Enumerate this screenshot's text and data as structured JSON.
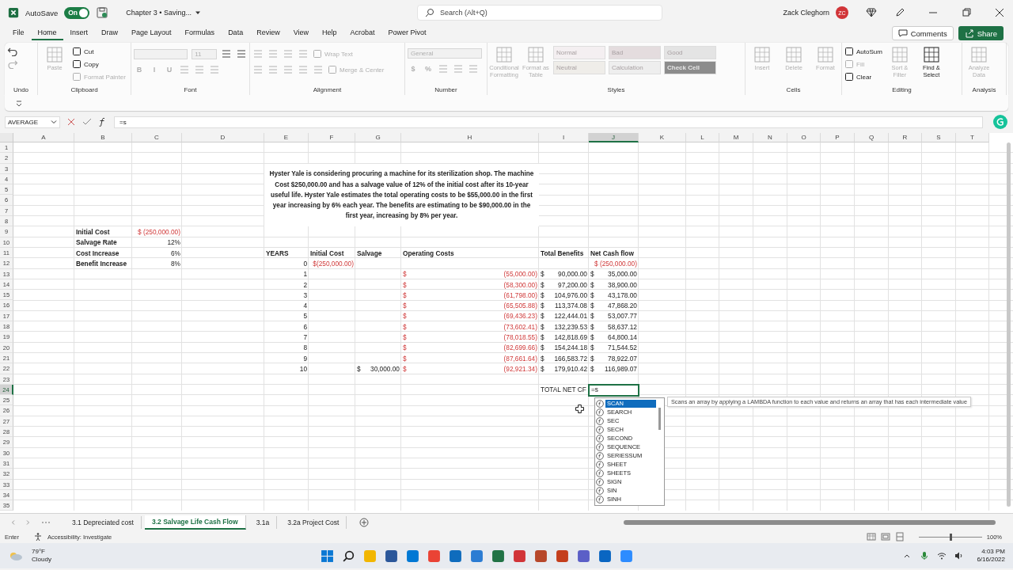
{
  "title_bar": {
    "autosave_label": "AutoSave",
    "autosave_toggle": {
      "text": "On",
      "on": true
    },
    "document": "Chapter 3 • Saving...",
    "search": {
      "placeholder": "Search (Alt+Q)"
    },
    "user": "Zack Cleghorn",
    "avatar": "ZC"
  },
  "menu": {
    "tabs": [
      {
        "label": "File",
        "selected": false
      },
      {
        "label": "Home",
        "selected": true
      },
      {
        "label": "Insert",
        "selected": false
      },
      {
        "label": "Draw",
        "selected": false
      },
      {
        "label": "Page Layout",
        "selected": false
      },
      {
        "label": "Formulas",
        "selected": false
      },
      {
        "label": "Data",
        "selected": false
      },
      {
        "label": "Review",
        "selected": false
      },
      {
        "label": "View",
        "selected": false
      },
      {
        "label": "Help",
        "selected": false
      },
      {
        "label": "Acrobat",
        "selected": false
      },
      {
        "label": "Power Pivot",
        "selected": false
      }
    ],
    "comments": "Comments",
    "share": "Share"
  },
  "ribbon": {
    "groups": [
      {
        "label": "Undo",
        "columns": [
          [
            {
              "kind": "undo",
              "disabled": false
            },
            {
              "kind": "redo",
              "disabled": true
            }
          ]
        ]
      },
      {
        "label": "Clipboard",
        "columns": [
          [
            {
              "kind": "large",
              "label": "Paste",
              "disabled": true
            }
          ],
          [
            {
              "kind": "small",
              "label": "Cut",
              "disabled": false
            },
            {
              "kind": "small",
              "label": "Copy",
              "disabled": false
            },
            {
              "kind": "small",
              "label": "Format Painter",
              "disabled": true
            }
          ]
        ]
      },
      {
        "label": "Font",
        "rows": [
          [
            {
              "kind": "font-field",
              "disabled": true
            },
            {
              "kind": "size-field",
              "value": "11",
              "disabled": true
            },
            {
              "kind": "icon",
              "disabled": false
            },
            {
              "kind": "icon",
              "disabled": false
            }
          ],
          [
            {
              "kind": "glyph",
              "label": "B",
              "disabled": true
            },
            {
              "kind": "glyph",
              "label": "I",
              "disabled": true
            },
            {
              "kind": "glyph",
              "label": "U",
              "disabled": true
            },
            {
              "kind": "icon",
              "disabled": true
            },
            {
              "kind": "icon",
              "disabled": true
            },
            {
              "kind": "icon",
              "disabled": true
            }
          ]
        ]
      },
      {
        "label": "Alignment",
        "rows": [
          [
            {
              "kind": "icon",
              "disabled": true
            },
            {
              "kind": "icon",
              "disabled": true
            },
            {
              "kind": "icon",
              "disabled": true
            },
            {
              "kind": "icon",
              "disabled": true
            },
            {
              "kind": "small",
              "label": "Wrap Text",
              "disabled": true
            }
          ],
          [
            {
              "kind": "icon",
              "disabled": true
            },
            {
              "kind": "icon",
              "disabled": true
            },
            {
              "kind": "icon",
              "disabled": true
            },
            {
              "kind": "icon",
              "disabled": true
            },
            {
              "kind": "icon",
              "disabled": true
            },
            {
              "kind": "small",
              "label": "Merge & Center",
              "disabled": true
            }
          ]
        ]
      },
      {
        "label": "Number",
        "rows": [
          [
            {
              "kind": "format-field",
              "value": "General",
              "disabled": true
            }
          ],
          [
            {
              "kind": "glyph",
              "label": "$",
              "disabled": true
            },
            {
              "kind": "glyph",
              "label": "%",
              "disabled": true
            },
            {
              "kind": "icon",
              "disabled": true
            },
            {
              "kind": "icon",
              "disabled": true
            },
            {
              "kind": "icon",
              "disabled": true
            }
          ]
        ]
      },
      {
        "label": "Styles",
        "columns": [
          [
            {
              "kind": "large",
              "label": "Conditional Formatting",
              "disabled": true
            }
          ],
          [
            {
              "kind": "large",
              "label": "Format as Table",
              "disabled": true
            }
          ],
          [
            {
              "kind": "style",
              "label": "Normal",
              "color": "#f4eff1",
              "disabled": true
            },
            {
              "kind": "style",
              "label": "Neutral",
              "color": "#efede9",
              "disabled": true
            }
          ],
          [
            {
              "kind": "style",
              "label": "Bad",
              "color": "#e4dcde",
              "disabled": true
            },
            {
              "kind": "style",
              "label": "Calculation",
              "color": "#eeeeee",
              "disabled": true
            }
          ],
          [
            {
              "kind": "style",
              "label": "Good",
              "color": "#e4e4e4",
              "disabled": true
            },
            {
              "kind": "style",
              "label": "Check Cell",
              "color": "#8c8c8c",
              "disabled": true
            }
          ]
        ]
      },
      {
        "label": "Cells",
        "columns": [
          [
            {
              "kind": "large",
              "label": "Insert",
              "disabled": true
            }
          ],
          [
            {
              "kind": "large",
              "label": "Delete",
              "disabled": true
            }
          ],
          [
            {
              "kind": "large",
              "label": "Format",
              "disabled": true
            }
          ]
        ]
      },
      {
        "label": "Editing",
        "columns": [
          [
            {
              "kind": "small",
              "label": "AutoSum",
              "disabled": false
            },
            {
              "kind": "small",
              "label": "Fill",
              "disabled": true
            },
            {
              "kind": "small",
              "label": "Clear",
              "disabled": false
            }
          ],
          [
            {
              "kind": "large",
              "label": "Sort & Filter",
              "disabled": true
            }
          ],
          [
            {
              "kind": "large",
              "label": "Find & Select",
              "disabled": false
            }
          ]
        ]
      },
      {
        "label": "Analysis",
        "columns": [
          [
            {
              "kind": "large",
              "label": "Analyze Data",
              "disabled": true
            }
          ]
        ]
      }
    ]
  },
  "formula_bar": {
    "name_box": "AVERAGE",
    "formula": "=s"
  },
  "sheet": {
    "columns": [
      {
        "label": "A",
        "selected": false
      },
      {
        "label": "B",
        "selected": false
      },
      {
        "label": "C",
        "selected": false
      },
      {
        "label": "D",
        "selected": false
      },
      {
        "label": "E",
        "selected": false
      },
      {
        "label": "F",
        "selected": false
      },
      {
        "label": "G",
        "selected": false
      },
      {
        "label": "H",
        "selected": false
      },
      {
        "label": "I",
        "selected": false
      },
      {
        "label": "J",
        "selected": true
      },
      {
        "label": "K",
        "selected": false
      },
      {
        "label": "L",
        "selected": false
      },
      {
        "label": "M",
        "selected": false
      },
      {
        "label": "N",
        "selected": false
      },
      {
        "label": "O",
        "selected": false
      },
      {
        "label": "P",
        "selected": false
      },
      {
        "label": "Q",
        "selected": false
      },
      {
        "label": "R",
        "selected": false
      },
      {
        "label": "S",
        "selected": false
      },
      {
        "label": "T",
        "selected": false
      }
    ],
    "note": "Hyster Yale is considering procuring a machine for its sterilization shop. The machine Cost $250,000.00 and has a salvage value of 12% of the initial cost after its 10-year useful life. Hyster Yale estimates the total operating costs to be $55,000.00 in the first year increasing by 6% each year. The benefits are estimating to be $90,000.00 in the first year, increasing by 8% per year.",
    "rows": [
      {
        "number": "1",
        "selected": false
      },
      {
        "number": "2",
        "selected": false
      },
      {
        "number": "3",
        "selected": false
      },
      {
        "number": "4",
        "selected": false
      },
      {
        "number": "5",
        "selected": false
      },
      {
        "number": "6",
        "selected": false
      },
      {
        "number": "7",
        "selected": false
      },
      {
        "number": "8",
        "selected": false
      },
      {
        "number": "9",
        "selected": false,
        "B": {
          "kind": "text",
          "text": "Initial Cost",
          "bold": true,
          "negative": false
        },
        "C": {
          "kind": "number",
          "text": "$ (250,000.00)",
          "bold": false,
          "negative": true
        }
      },
      {
        "number": "10",
        "selected": false,
        "B": {
          "kind": "text",
          "text": "Salvage Rate",
          "bold": true,
          "negative": false
        },
        "C": {
          "kind": "number",
          "text": "12%",
          "bold": false,
          "negative": false
        }
      },
      {
        "number": "11",
        "selected": false,
        "B": {
          "kind": "text",
          "text": "Cost Increase",
          "bold": true,
          "negative": false
        },
        "C": {
          "kind": "number",
          "text": "6%",
          "bold": false,
          "negative": false
        },
        "E": {
          "kind": "text",
          "text": "YEARS",
          "bold": true,
          "negative": false
        },
        "F": {
          "kind": "text",
          "text": "Initial Cost",
          "bold": true,
          "negative": false
        },
        "G": {
          "kind": "text",
          "text": "Salvage",
          "bold": true,
          "negative": false
        },
        "H": {
          "kind": "text",
          "text": "Operating Costs",
          "bold": true,
          "negative": false
        },
        "I": {
          "kind": "text",
          "text": "Total Benefits",
          "bold": true,
          "negative": false
        },
        "J": {
          "kind": "text",
          "text": "Net Cash flow",
          "bold": true,
          "negative": false
        }
      },
      {
        "number": "12",
        "selected": false,
        "B": {
          "kind": "text",
          "text": "Benefit Increase",
          "bold": true,
          "negative": false
        },
        "C": {
          "kind": "number",
          "text": "8%",
          "bold": false,
          "negative": false
        },
        "E": {
          "kind": "number",
          "text": "0",
          "bold": false,
          "negative": false
        },
        "F": {
          "kind": "number",
          "text": "$(250,000.00)",
          "bold": false,
          "negative": true
        },
        "J": {
          "kind": "number",
          "text": "$ (250,000.00)",
          "bold": false,
          "negative": true
        }
      },
      {
        "number": "13",
        "selected": false,
        "E": {
          "kind": "number",
          "text": "1",
          "bold": false,
          "negative": false
        },
        "H": {
          "kind": "accounting",
          "symbol": "$",
          "text": "(55,000.00)",
          "bold": false,
          "negative": true
        },
        "I": {
          "kind": "accounting",
          "symbol": "$",
          "text": "90,000.00",
          "bold": false,
          "negative": false
        },
        "J": {
          "kind": "accounting",
          "symbol": "$",
          "text": "35,000.00",
          "bold": false,
          "negative": false
        }
      },
      {
        "number": "14",
        "selected": false,
        "E": {
          "kind": "number",
          "text": "2",
          "bold": false,
          "negative": false
        },
        "H": {
          "kind": "accounting",
          "symbol": "$",
          "text": "(58,300.00)",
          "bold": false,
          "negative": true
        },
        "I": {
          "kind": "accounting",
          "symbol": "$",
          "text": "97,200.00",
          "bold": false,
          "negative": false
        },
        "J": {
          "kind": "accounting",
          "symbol": "$",
          "text": "38,900.00",
          "bold": false,
          "negative": false
        }
      },
      {
        "number": "15",
        "selected": false,
        "E": {
          "kind": "number",
          "text": "3",
          "bold": false,
          "negative": false
        },
        "H": {
          "kind": "accounting",
          "symbol": "$",
          "text": "(61,798.00)",
          "bold": false,
          "negative": true
        },
        "I": {
          "kind": "accounting",
          "symbol": "$",
          "text": "104,976.00",
          "bold": false,
          "negative": false
        },
        "J": {
          "kind": "accounting",
          "symbol": "$",
          "text": "43,178.00",
          "bold": false,
          "negative": false
        }
      },
      {
        "number": "16",
        "selected": false,
        "E": {
          "kind": "number",
          "text": "4",
          "bold": false,
          "negative": false
        },
        "H": {
          "kind": "accounting",
          "symbol": "$",
          "text": "(65,505.88)",
          "bold": false,
          "negative": true
        },
        "I": {
          "kind": "accounting",
          "symbol": "$",
          "text": "113,374.08",
          "bold": false,
          "negative": false
        },
        "J": {
          "kind": "accounting",
          "symbol": "$",
          "text": "47,868.20",
          "bold": false,
          "negative": false
        }
      },
      {
        "number": "17",
        "selected": false,
        "E": {
          "kind": "number",
          "text": "5",
          "bold": false,
          "negative": false
        },
        "H": {
          "kind": "accounting",
          "symbol": "$",
          "text": "(69,436.23)",
          "bold": false,
          "negative": true
        },
        "I": {
          "kind": "accounting",
          "symbol": "$",
          "text": "122,444.01",
          "bold": false,
          "negative": false
        },
        "J": {
          "kind": "accounting",
          "symbol": "$",
          "text": "53,007.77",
          "bold": false,
          "negative": false
        }
      },
      {
        "number": "18",
        "selected": false,
        "E": {
          "kind": "number",
          "text": "6",
          "bold": false,
          "negative": false
        },
        "H": {
          "kind": "accounting",
          "symbol": "$",
          "text": "(73,602.41)",
          "bold": false,
          "negative": true
        },
        "I": {
          "kind": "accounting",
          "symbol": "$",
          "text": "132,239.53",
          "bold": false,
          "negative": false
        },
        "J": {
          "kind": "accounting",
          "symbol": "$",
          "text": "58,637.12",
          "bold": false,
          "negative": false
        }
      },
      {
        "number": "19",
        "selected": false,
        "E": {
          "kind": "number",
          "text": "7",
          "bold": false,
          "negative": false
        },
        "H": {
          "kind": "accounting",
          "symbol": "$",
          "text": "(78,018.55)",
          "bold": false,
          "negative": true
        },
        "I": {
          "kind": "accounting",
          "symbol": "$",
          "text": "142,818.69",
          "bold": false,
          "negative": false
        },
        "J": {
          "kind": "accounting",
          "symbol": "$",
          "text": "64,800.14",
          "bold": false,
          "negative": false
        }
      },
      {
        "number": "20",
        "selected": false,
        "E": {
          "kind": "number",
          "text": "8",
          "bold": false,
          "negative": false
        },
        "H": {
          "kind": "accounting",
          "symbol": "$",
          "text": "(82,699.66)",
          "bold": false,
          "negative": true
        },
        "I": {
          "kind": "accounting",
          "symbol": "$",
          "text": "154,244.18",
          "bold": false,
          "negative": false
        },
        "J": {
          "kind": "accounting",
          "symbol": "$",
          "text": "71,544.52",
          "bold": false,
          "negative": false
        }
      },
      {
        "number": "21",
        "selected": false,
        "E": {
          "kind": "number",
          "text": "9",
          "bold": false,
          "negative": false
        },
        "H": {
          "kind": "accounting",
          "symbol": "$",
          "text": "(87,661.64)",
          "bold": false,
          "negative": true
        },
        "I": {
          "kind": "accounting",
          "symbol": "$",
          "text": "166,583.72",
          "bold": false,
          "negative": false
        },
        "J": {
          "kind": "accounting",
          "symbol": "$",
          "text": "78,922.07",
          "bold": false,
          "negative": false
        }
      },
      {
        "number": "22",
        "selected": false,
        "E": {
          "kind": "number",
          "text": "10",
          "bold": false,
          "negative": false
        },
        "G": {
          "kind": "accounting",
          "symbol": "$",
          "text": "30,000.00",
          "bold": false,
          "negative": false
        },
        "H": {
          "kind": "accounting",
          "symbol": "$",
          "text": "(92,921.34)",
          "bold": false,
          "negative": true
        },
        "I": {
          "kind": "accounting",
          "symbol": "$",
          "text": "179,910.42",
          "bold": false,
          "negative": false
        },
        "J": {
          "kind": "accounting",
          "symbol": "$",
          "text": "116,989.07",
          "bold": false,
          "negative": false
        }
      },
      {
        "number": "23",
        "selected": false
      },
      {
        "number": "24",
        "selected": true,
        "I": {
          "kind": "text",
          "text": "TOTAL NET CF",
          "bold": false,
          "negative": false
        },
        "J": {
          "kind": "editing",
          "text": "=s"
        }
      },
      {
        "number": "25",
        "selected": false
      },
      {
        "number": "26",
        "selected": false
      },
      {
        "number": "27",
        "selected": false
      },
      {
        "number": "28",
        "selected": false
      },
      {
        "number": "29",
        "selected": false
      },
      {
        "number": "30",
        "selected": false
      },
      {
        "number": "31",
        "selected": false
      },
      {
        "number": "32",
        "selected": false
      },
      {
        "number": "33",
        "selected": false
      },
      {
        "number": "34",
        "selected": false
      },
      {
        "number": "35",
        "selected": false
      }
    ],
    "autocomplete": {
      "items": [
        {
          "label": "SCAN",
          "selected": true
        },
        {
          "label": "SEARCH",
          "selected": false
        },
        {
          "label": "SEC",
          "selected": false
        },
        {
          "label": "SECH",
          "selected": false
        },
        {
          "label": "SECOND",
          "selected": false
        },
        {
          "label": "SEQUENCE",
          "selected": false
        },
        {
          "label": "SERIESSUM",
          "selected": false
        },
        {
          "label": "SHEET",
          "selected": false
        },
        {
          "label": "SHEETS",
          "selected": false
        },
        {
          "label": "SIGN",
          "selected": false
        },
        {
          "label": "SIN",
          "selected": false
        },
        {
          "label": "SINH",
          "selected": false
        }
      ],
      "tooltip": "Scans an array by applying a LAMBDA function to each value and returns an array that has each intermediate value"
    }
  },
  "sheet_tabs": [
    {
      "label": "3.1 Depreciated cost",
      "selected": false
    },
    {
      "label": "3.2 Salvage Life Cash Flow",
      "selected": true
    },
    {
      "label": "3.1a",
      "selected": false
    },
    {
      "label": "3.2a Project Cost",
      "selected": false
    }
  ],
  "status_bar": {
    "mode": "Enter",
    "accessibility": "Accessibility: Investigate",
    "zoom": {
      "level": 0.5,
      "text": "100%"
    }
  },
  "taskbar": {
    "weather": {
      "temperature": "79°F",
      "condition": "Cloudy"
    },
    "time": "4:03 PM",
    "date": "6/16/2022"
  }
}
